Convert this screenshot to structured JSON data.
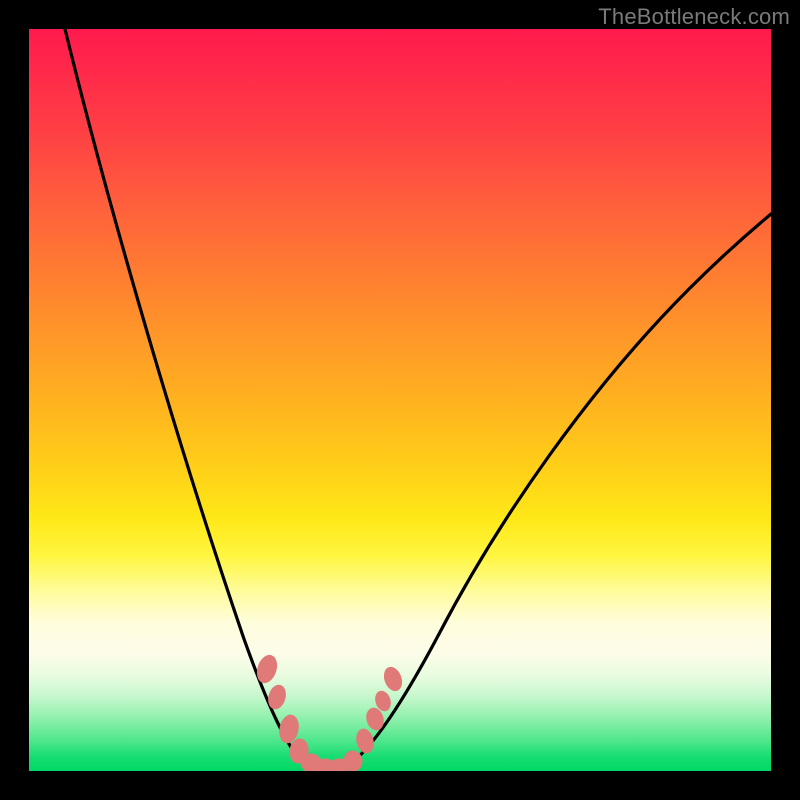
{
  "watermark": "TheBottleneck.com",
  "chart_data": {
    "type": "line",
    "title": "",
    "xlabel": "",
    "ylabel": "",
    "xlim": [
      0,
      100
    ],
    "ylim": [
      0,
      100
    ],
    "series": [
      {
        "name": "bottleneck-curve",
        "x": [
          5,
          10,
          15,
          20,
          25,
          30,
          32,
          34,
          36,
          38,
          40,
          42,
          44,
          48,
          55,
          65,
          75,
          85,
          95,
          100
        ],
        "y": [
          100,
          82,
          66,
          50,
          35,
          20,
          14,
          8,
          3,
          0,
          0,
          0,
          3,
          10,
          22,
          38,
          52,
          63,
          72,
          76
        ]
      }
    ],
    "markers": {
      "name": "highlight-points",
      "x": [
        31,
        32.5,
        34,
        35.5,
        37,
        38.5,
        40,
        41.5,
        43,
        44.5,
        46
      ],
      "y": [
        15,
        10,
        5,
        2,
        0,
        0,
        0,
        0,
        2,
        5,
        9
      ]
    },
    "gradient_bands": [
      {
        "color": "#ff1a4d",
        "stop": 0
      },
      {
        "color": "#ff7a32",
        "stop": 32
      },
      {
        "color": "#ffd218",
        "stop": 60
      },
      {
        "color": "#fffca0",
        "stop": 76
      },
      {
        "color": "#8df0ab",
        "stop": 93
      },
      {
        "color": "#00d865",
        "stop": 100
      }
    ]
  }
}
